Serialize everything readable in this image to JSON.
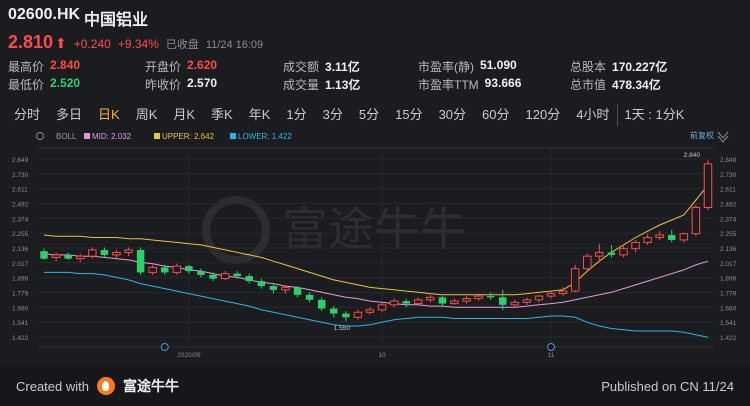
{
  "header": {
    "code": "02600.HK",
    "name": "中国铝业",
    "price": "2.810",
    "arrow": "⬆",
    "change": "+0.240",
    "change_pct": "+9.34%",
    "status": "已收盘",
    "datetime": "11/24 16:09"
  },
  "stats": [
    {
      "label": "最高价",
      "value": "2.840",
      "tone": "red"
    },
    {
      "label": "开盘价",
      "value": "2.620",
      "tone": "red"
    },
    {
      "label": "成交额",
      "value": "3.11亿",
      "tone": "plain"
    },
    {
      "label": "市盈率(静)",
      "value": "51.090",
      "tone": "plain"
    },
    {
      "label": "总股本",
      "value": "170.227亿",
      "tone": "plain"
    },
    {
      "label": "最低价",
      "value": "2.520",
      "tone": "grn"
    },
    {
      "label": "昨收价",
      "value": "2.570",
      "tone": "plain"
    },
    {
      "label": "成交量",
      "value": "1.13亿",
      "tone": "plain"
    },
    {
      "label": "市盈率TTM",
      "value": "93.666",
      "tone": "plain"
    },
    {
      "label": "总市值",
      "value": "478.34亿",
      "tone": "plain"
    }
  ],
  "tabs": [
    "分时",
    "多日",
    "日K",
    "周K",
    "月K",
    "季K",
    "年K",
    "1分",
    "3分",
    "5分",
    "15分",
    "30分",
    "60分",
    "120分",
    "4小时",
    "1天 : 1分K"
  ],
  "active_tab": "日K",
  "footer": {
    "created": "Created with",
    "brand": "富途牛牛",
    "published": "Published on CN 11/24"
  },
  "watermark": "富途牛牛",
  "colors": {
    "up": "#ff4a4a",
    "down": "#2ecf6a",
    "mid": "#e39bd7",
    "upper": "#e8c43b",
    "lower": "#25b9e6",
    "active_tab": "#ffb22e"
  },
  "chart_data": {
    "type": "candlestick",
    "indicator": "BOLL",
    "legend": {
      "mid": "MID: 2.032",
      "upper": "UPPER: 2.642",
      "lower": "LOWER: 1.422",
      "restore": "前复权"
    },
    "y_ticks": [
      "2.849",
      "2.730",
      "2.611",
      "2.492",
      "2.374",
      "2.255",
      "2.136",
      "2.017",
      "1.898",
      "1.779",
      "1.660",
      "1.541",
      "1.422"
    ],
    "ylim": [
      1.422,
      2.849
    ],
    "x_labels": [
      {
        "label": "2020/09",
        "index": 12
      },
      {
        "label": "10",
        "index": 28
      },
      {
        "label": "11",
        "index": 42
      }
    ],
    "annotations": {
      "high": "2.840",
      "low": "1.550"
    },
    "ohlc": [
      [
        2.11,
        2.13,
        2.04,
        2.05
      ],
      [
        2.06,
        2.1,
        2.03,
        2.08
      ],
      [
        2.08,
        2.1,
        2.04,
        2.05
      ],
      [
        2.05,
        2.09,
        2.02,
        2.07
      ],
      [
        2.07,
        2.14,
        2.05,
        2.12
      ],
      [
        2.12,
        2.14,
        2.06,
        2.08
      ],
      [
        2.08,
        2.12,
        2.05,
        2.1
      ],
      [
        2.1,
        2.14,
        2.07,
        2.12
      ],
      [
        2.12,
        2.14,
        1.92,
        1.94
      ],
      [
        1.94,
        2.0,
        1.92,
        1.98
      ],
      [
        1.98,
        2.0,
        1.92,
        1.94
      ],
      [
        1.94,
        2.01,
        1.92,
        1.99
      ],
      [
        1.99,
        2.0,
        1.93,
        1.95
      ],
      [
        1.95,
        1.97,
        1.9,
        1.92
      ],
      [
        1.92,
        1.94,
        1.87,
        1.89
      ],
      [
        1.89,
        1.95,
        1.88,
        1.93
      ],
      [
        1.93,
        1.95,
        1.89,
        1.91
      ],
      [
        1.91,
        1.93,
        1.85,
        1.87
      ],
      [
        1.87,
        1.89,
        1.81,
        1.83
      ],
      [
        1.83,
        1.85,
        1.77,
        1.8
      ],
      [
        1.8,
        1.84,
        1.77,
        1.82
      ],
      [
        1.82,
        1.83,
        1.74,
        1.76
      ],
      [
        1.76,
        1.78,
        1.7,
        1.72
      ],
      [
        1.72,
        1.74,
        1.63,
        1.65
      ],
      [
        1.65,
        1.67,
        1.58,
        1.61
      ],
      [
        1.61,
        1.63,
        1.55,
        1.58
      ],
      [
        1.58,
        1.64,
        1.56,
        1.62
      ],
      [
        1.62,
        1.66,
        1.6,
        1.64
      ],
      [
        1.64,
        1.7,
        1.62,
        1.68
      ],
      [
        1.68,
        1.73,
        1.66,
        1.71
      ],
      [
        1.71,
        1.73,
        1.66,
        1.69
      ],
      [
        1.69,
        1.74,
        1.67,
        1.72
      ],
      [
        1.72,
        1.76,
        1.7,
        1.74
      ],
      [
        1.74,
        1.75,
        1.67,
        1.69
      ],
      [
        1.69,
        1.73,
        1.68,
        1.71
      ],
      [
        1.71,
        1.75,
        1.69,
        1.73
      ],
      [
        1.73,
        1.77,
        1.71,
        1.75
      ],
      [
        1.75,
        1.78,
        1.72,
        1.74
      ],
      [
        1.74,
        1.8,
        1.64,
        1.68
      ],
      [
        1.68,
        1.72,
        1.66,
        1.7
      ],
      [
        1.7,
        1.74,
        1.68,
        1.72
      ],
      [
        1.72,
        1.76,
        1.7,
        1.75
      ],
      [
        1.75,
        1.79,
        1.73,
        1.77
      ],
      [
        1.77,
        1.82,
        1.75,
        1.79
      ],
      [
        1.79,
        2.0,
        1.78,
        1.97
      ],
      [
        1.97,
        2.09,
        1.95,
        2.07
      ],
      [
        2.07,
        2.17,
        2.03,
        2.1
      ],
      [
        2.1,
        2.16,
        2.06,
        2.08
      ],
      [
        2.08,
        2.15,
        2.06,
        2.13
      ],
      [
        2.13,
        2.2,
        2.1,
        2.18
      ],
      [
        2.18,
        2.25,
        2.16,
        2.22
      ],
      [
        2.22,
        2.27,
        2.2,
        2.24
      ],
      [
        2.24,
        2.28,
        2.18,
        2.2
      ],
      [
        2.2,
        2.26,
        2.18,
        2.25
      ],
      [
        2.25,
        2.48,
        2.23,
        2.46
      ],
      [
        2.46,
        2.84,
        2.44,
        2.81
      ]
    ],
    "mid": [
      2.09,
      2.08,
      2.08,
      2.07,
      2.07,
      2.06,
      2.05,
      2.04,
      2.02,
      2.01,
      1.99,
      1.98,
      1.96,
      1.95,
      1.93,
      1.91,
      1.9,
      1.88,
      1.86,
      1.85,
      1.83,
      1.82,
      1.8,
      1.78,
      1.76,
      1.74,
      1.73,
      1.71,
      1.7,
      1.69,
      1.68,
      1.68,
      1.67,
      1.67,
      1.66,
      1.66,
      1.66,
      1.66,
      1.66,
      1.66,
      1.67,
      1.68,
      1.69,
      1.7,
      1.72,
      1.74,
      1.76,
      1.78,
      1.81,
      1.84,
      1.87,
      1.9,
      1.93,
      1.96,
      2.0,
      2.03
    ],
    "upper": [
      2.24,
      2.23,
      2.23,
      2.23,
      2.22,
      2.22,
      2.22,
      2.21,
      2.21,
      2.2,
      2.19,
      2.18,
      2.17,
      2.16,
      2.14,
      2.12,
      2.1,
      2.08,
      2.06,
      2.03,
      2.0,
      1.97,
      1.94,
      1.91,
      1.88,
      1.86,
      1.84,
      1.82,
      1.81,
      1.8,
      1.79,
      1.78,
      1.77,
      1.76,
      1.76,
      1.76,
      1.76,
      1.76,
      1.76,
      1.76,
      1.77,
      1.78,
      1.79,
      1.8,
      1.86,
      1.95,
      2.03,
      2.1,
      2.16,
      2.22,
      2.27,
      2.32,
      2.36,
      2.4,
      2.52,
      2.64
    ],
    "lower": [
      1.94,
      1.94,
      1.94,
      1.93,
      1.93,
      1.92,
      1.9,
      1.88,
      1.85,
      1.83,
      1.81,
      1.79,
      1.77,
      1.75,
      1.73,
      1.71,
      1.69,
      1.67,
      1.64,
      1.62,
      1.6,
      1.58,
      1.56,
      1.54,
      1.52,
      1.51,
      1.51,
      1.52,
      1.54,
      1.56,
      1.57,
      1.58,
      1.58,
      1.58,
      1.57,
      1.57,
      1.57,
      1.57,
      1.57,
      1.57,
      1.57,
      1.58,
      1.59,
      1.59,
      1.58,
      1.54,
      1.51,
      1.49,
      1.48,
      1.47,
      1.47,
      1.47,
      1.47,
      1.46,
      1.44,
      1.42
    ]
  }
}
